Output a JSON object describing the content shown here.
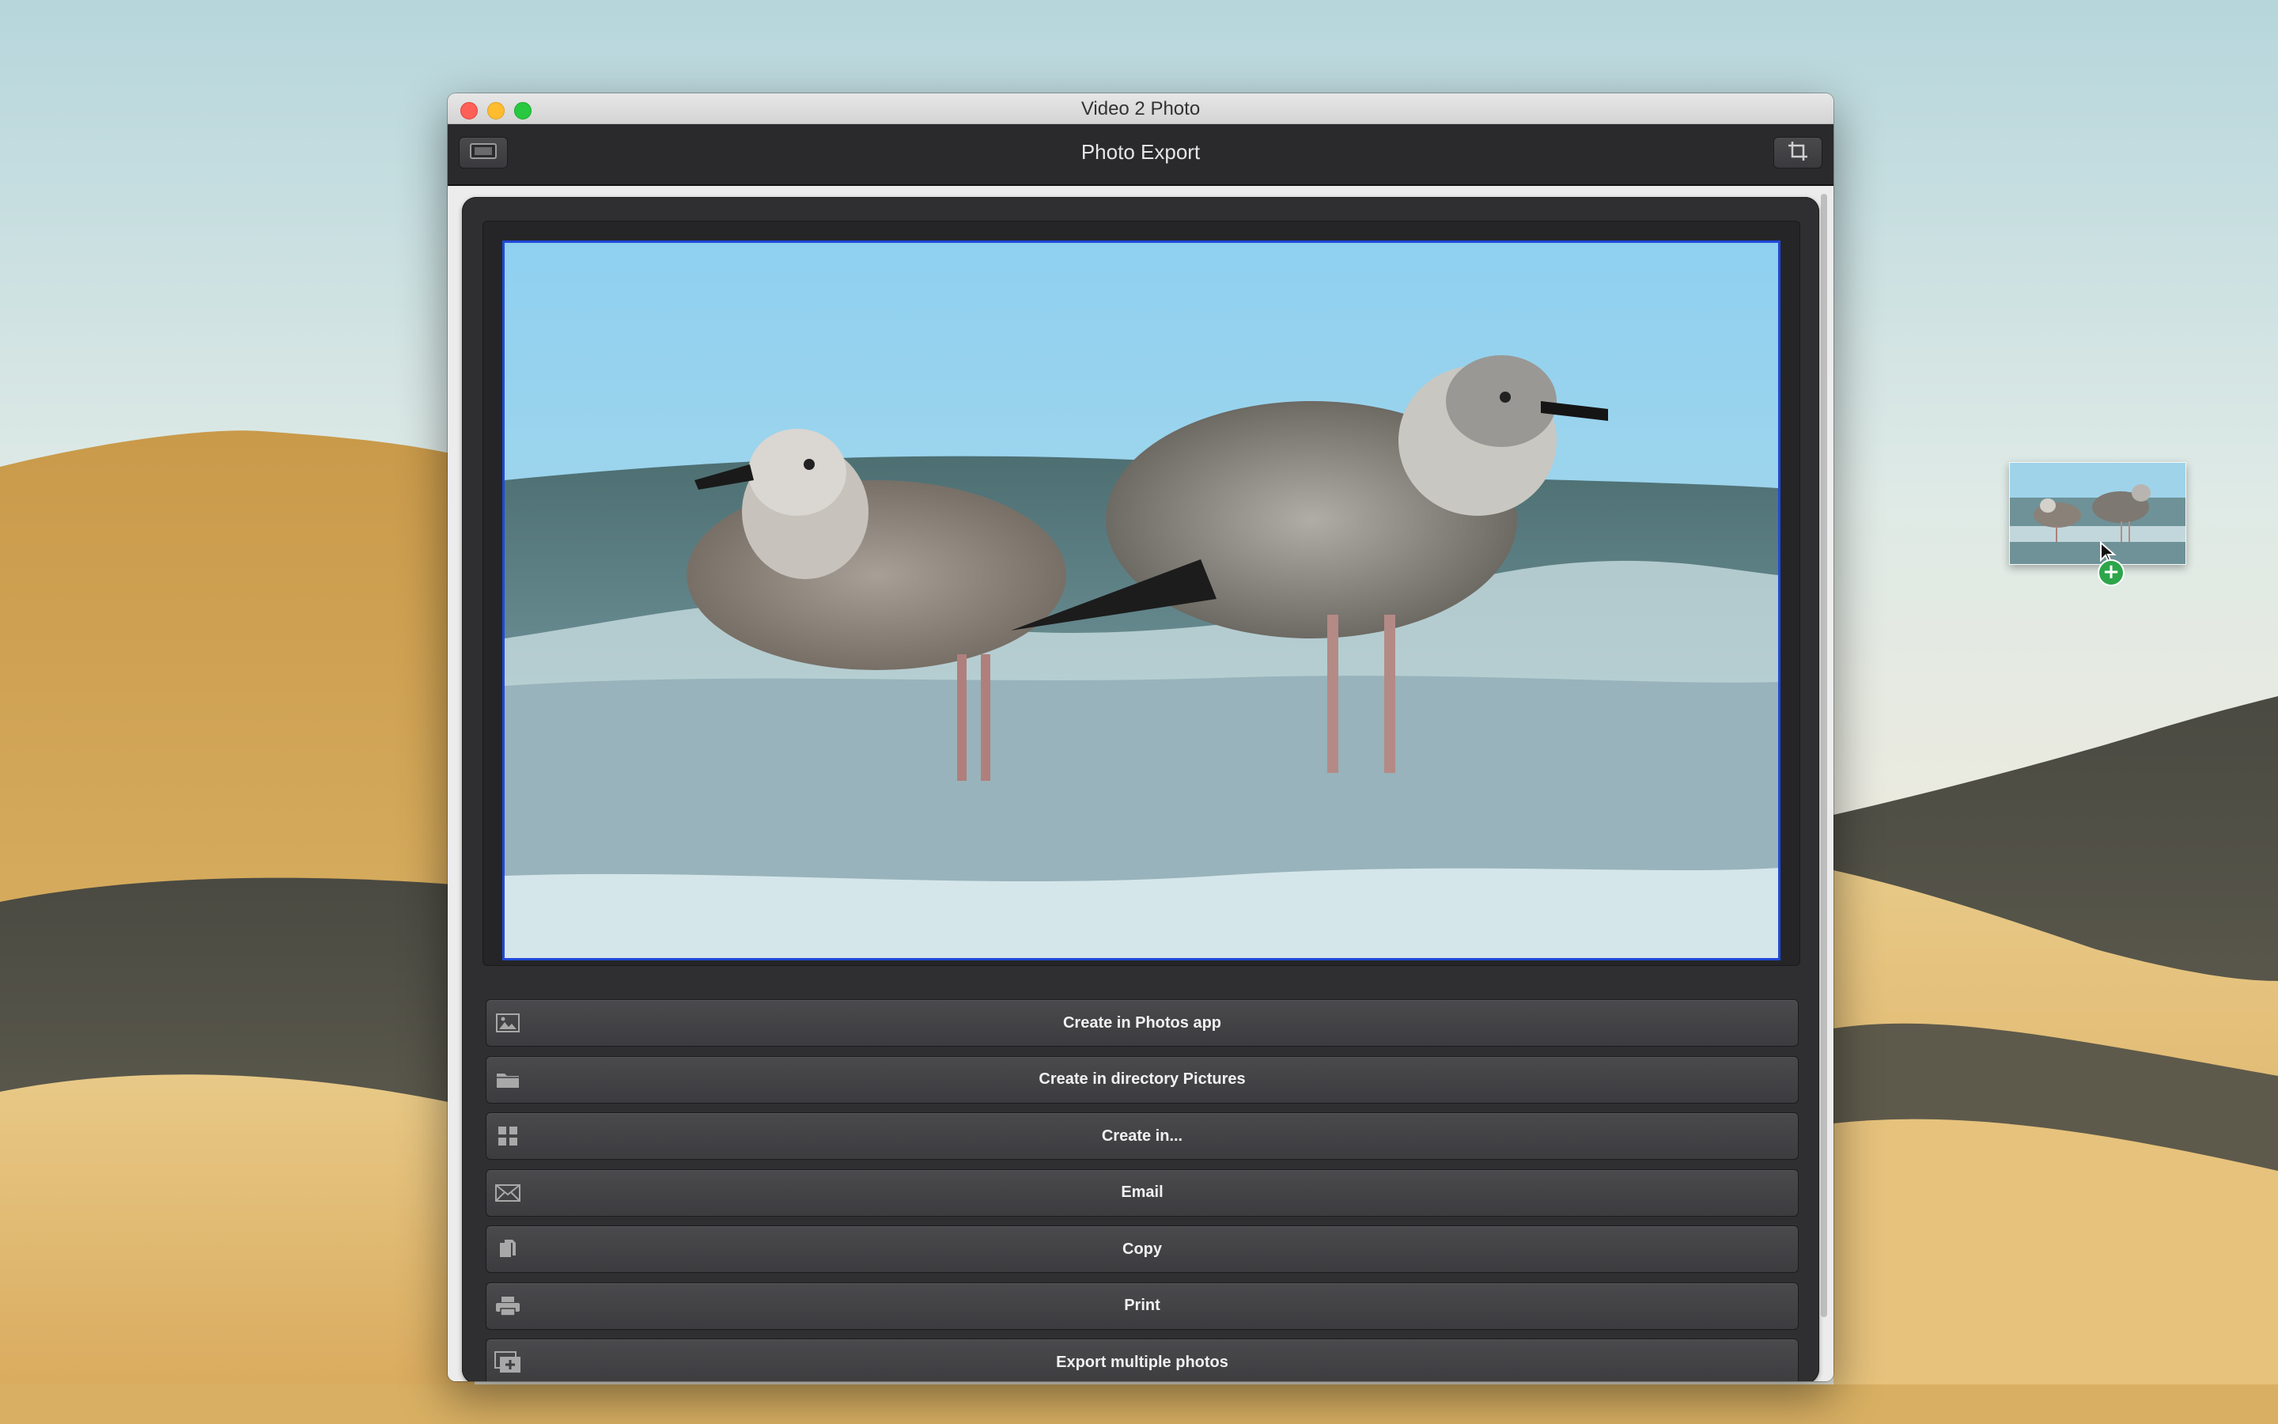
{
  "window": {
    "title": "Video 2 Photo",
    "toolbar_title": "Photo Export",
    "left_toolbar_icon": "film-icon",
    "right_toolbar_icon": "crop-icon"
  },
  "photo": {
    "subject": "two gulls standing in surf",
    "selected_border_color": "#1f49d8"
  },
  "actions": [
    {
      "label": "Create in Photos app",
      "icon": "photo-icon"
    },
    {
      "label": "Create in directory Pictures",
      "icon": "folder-icon"
    },
    {
      "label": "Create in...",
      "icon": "grid-icon"
    },
    {
      "label": "Email",
      "icon": "envelope-icon"
    },
    {
      "label": "Copy",
      "icon": "copy-icon"
    },
    {
      "label": "Print",
      "icon": "printer-icon"
    },
    {
      "label": "Export multiple photos",
      "icon": "add-stack-icon"
    }
  ],
  "drag": {
    "badge": "+",
    "badge_color": "#2da64a"
  }
}
